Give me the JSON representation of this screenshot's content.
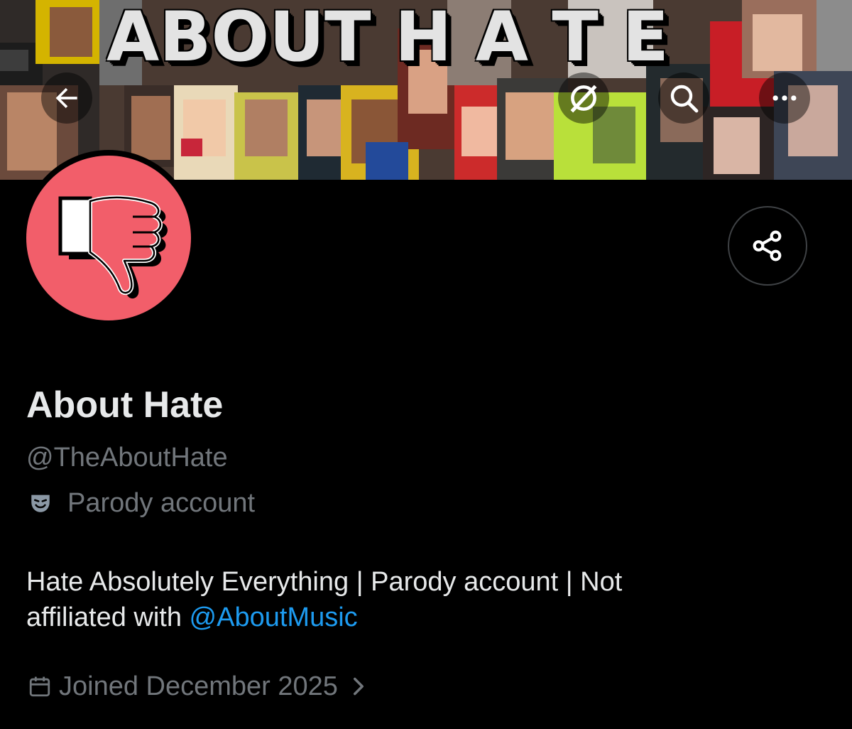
{
  "banner": {
    "title": "ABOUT H A T E",
    "image": "music-artists-pixel-collage"
  },
  "nav": {
    "back_icon": "arrow-left-icon",
    "grok_icon": "grok-icon",
    "search_icon": "search-icon",
    "more_icon": "more-horizontal-icon"
  },
  "avatar": {
    "icon": "thumbs-down-icon",
    "background_color": "#f25e6a"
  },
  "share": {
    "icon": "share-icon"
  },
  "profile": {
    "display_name": "About Hate",
    "handle": "@TheAboutHate",
    "label_icon": "theater-mask-icon",
    "label": "Parody account",
    "bio_line1": "Hate Absolutely Everything | Parody account | Not",
    "bio_line2_prefix": "affiliated with ",
    "bio_mention": "@AboutMusic",
    "joined_icon": "calendar-icon",
    "joined": "Joined December 2025",
    "joined_chevron": "chevron-right-icon"
  },
  "colors": {
    "background": "#000000",
    "primary_text": "#e7e9ea",
    "secondary_text": "#71767b",
    "link": "#1d9bf0",
    "avatar_bg": "#f25e6a"
  }
}
